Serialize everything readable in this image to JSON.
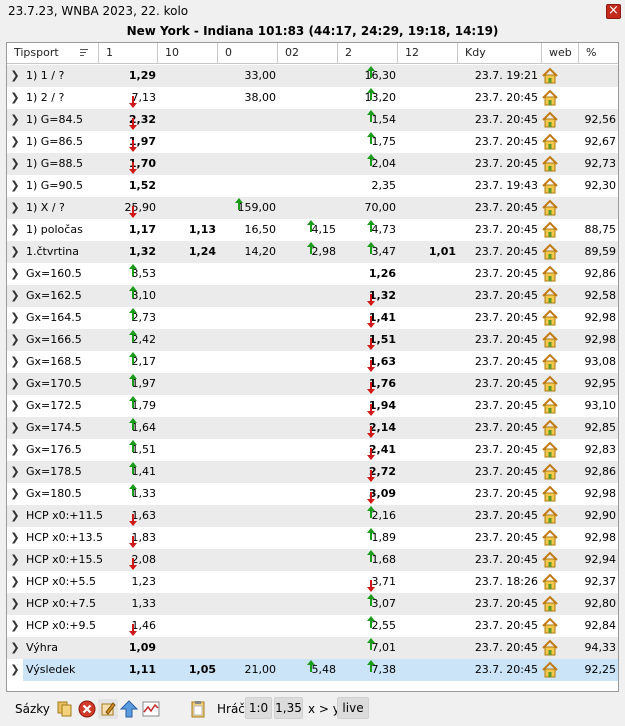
{
  "window": {
    "title": "23.7.23, WNBA 2023, 22. kolo",
    "close_symbol": "×"
  },
  "match_header": "New York - Indiana 101:83 (44:17, 24:29, 19:18, 14:19)",
  "columns": [
    "Tipsport",
    "1",
    "10",
    "0",
    "02",
    "2",
    "12",
    "Kdy",
    "web",
    "%"
  ],
  "colors": {
    "up_arrow": "#1a9c1a",
    "down_arrow": "#d01818",
    "alt_row": "#ebebeb",
    "selected_row": "#cce4f7",
    "house_icon": "#d99a1e"
  },
  "rows": [
    {
      "name": "1) 1 / ?",
      "c1": "1,29",
      "c1b": true,
      "c3": "33,00",
      "c5": "16,30",
      "c5a": "up",
      "kdy": "23.7. 19:21",
      "pct": ""
    },
    {
      "name": "1) 2 / ?",
      "c1": "7,13",
      "c1a": "down",
      "c3": "38,00",
      "c5": "13,20",
      "c5a": "up",
      "kdy": "23.7. 20:45",
      "pct": ""
    },
    {
      "name": "1) G=84.5",
      "c1": "2,32",
      "c1b": true,
      "c1a": "down",
      "c5": "1,54",
      "c5a": "up",
      "kdy": "23.7. 20:45",
      "pct": "92,56"
    },
    {
      "name": "1) G=86.5",
      "c1": "1,97",
      "c1b": true,
      "c1a": "down",
      "c5": "1,75",
      "c5a": "up",
      "kdy": "23.7. 20:45",
      "pct": "92,67"
    },
    {
      "name": "1) G=88.5",
      "c1": "1,70",
      "c1b": true,
      "c1a": "down",
      "c5": "2,04",
      "c5a": "up",
      "kdy": "23.7. 20:45",
      "pct": "92,73"
    },
    {
      "name": "1) G=90.5",
      "c1": "1,52",
      "c1b": true,
      "c5": "2,35",
      "kdy": "23.7. 19:43",
      "pct": "92,30"
    },
    {
      "name": "1) X / ?",
      "c1": "25,90",
      "c1a": "down",
      "c3": "159,00",
      "c3a": "up",
      "c5": "70,00",
      "kdy": "23.7. 20:45",
      "pct": ""
    },
    {
      "name": "1) poločas",
      "c1": "1,17",
      "c1b": true,
      "c2": "1,13",
      "c2b": true,
      "c3": "16,50",
      "c4": "4,15",
      "c4a": "up",
      "c5": "4,73",
      "c5a": "up",
      "kdy": "23.7. 20:45",
      "pct": "88,75"
    },
    {
      "name": "1.čtvrtina",
      "c1": "1,32",
      "c1b": true,
      "c2": "1,24",
      "c2b": true,
      "c3": "14,20",
      "c4": "2,98",
      "c4a": "up",
      "c5": "3,47",
      "c5a": "up",
      "c6": "1,01",
      "c6b": true,
      "kdy": "23.7. 20:45",
      "pct": "89,59"
    },
    {
      "name": "Gx=160.5",
      "c1": "3,53",
      "c1a": "up",
      "c5": "1,26",
      "c5b": true,
      "kdy": "23.7. 20:45",
      "pct": "92,86"
    },
    {
      "name": "Gx=162.5",
      "c1": "3,10",
      "c1a": "up",
      "c5": "1,32",
      "c5b": true,
      "c5a": "down",
      "kdy": "23.7. 20:45",
      "pct": "92,58"
    },
    {
      "name": "Gx=164.5",
      "c1": "2,73",
      "c1a": "up",
      "c5": "1,41",
      "c5b": true,
      "c5a": "down",
      "kdy": "23.7. 20:45",
      "pct": "92,98"
    },
    {
      "name": "Gx=166.5",
      "c1": "2,42",
      "c1a": "up",
      "c5": "1,51",
      "c5b": true,
      "c5a": "down",
      "kdy": "23.7. 20:45",
      "pct": "92,98"
    },
    {
      "name": "Gx=168.5",
      "c1": "2,17",
      "c1a": "up",
      "c5": "1,63",
      "c5b": true,
      "c5a": "down",
      "kdy": "23.7. 20:45",
      "pct": "93,08"
    },
    {
      "name": "Gx=170.5",
      "c1": "1,97",
      "c1a": "up",
      "c5": "1,76",
      "c5b": true,
      "c5a": "down",
      "kdy": "23.7. 20:45",
      "pct": "92,95"
    },
    {
      "name": "Gx=172.5",
      "c1": "1,79",
      "c1a": "up",
      "c5": "1,94",
      "c5b": true,
      "c5a": "down",
      "kdy": "23.7. 20:45",
      "pct": "93,10"
    },
    {
      "name": "Gx=174.5",
      "c1": "1,64",
      "c1a": "up",
      "c5": "2,14",
      "c5b": true,
      "c5a": "down",
      "kdy": "23.7. 20:45",
      "pct": "92,85"
    },
    {
      "name": "Gx=176.5",
      "c1": "1,51",
      "c1a": "up",
      "c5": "2,41",
      "c5b": true,
      "c5a": "down",
      "kdy": "23.7. 20:45",
      "pct": "92,83"
    },
    {
      "name": "Gx=178.5",
      "c1": "1,41",
      "c1a": "up",
      "c5": "2,72",
      "c5b": true,
      "c5a": "down",
      "kdy": "23.7. 20:45",
      "pct": "92,86"
    },
    {
      "name": "Gx=180.5",
      "c1": "1,33",
      "c1a": "up",
      "c5": "3,09",
      "c5b": true,
      "c5a": "down",
      "kdy": "23.7. 20:45",
      "pct": "92,98"
    },
    {
      "name": "HCP x0:+11.5",
      "c1": "1,63",
      "c1a": "down",
      "c5": "2,16",
      "c5a": "up",
      "kdy": "23.7. 20:45",
      "pct": "92,90"
    },
    {
      "name": "HCP x0:+13.5",
      "c1": "1,83",
      "c1a": "down",
      "c5": "1,89",
      "c5a": "up",
      "kdy": "23.7. 20:45",
      "pct": "92,98"
    },
    {
      "name": "HCP x0:+15.5",
      "c1": "2,08",
      "c1a": "down",
      "c5": "1,68",
      "c5a": "up",
      "kdy": "23.7. 20:45",
      "pct": "92,94"
    },
    {
      "name": "HCP x0:+5.5",
      "c1": "1,23",
      "c5": "3,71",
      "c5a": "down",
      "kdy": "23.7. 18:26",
      "pct": "92,37"
    },
    {
      "name": "HCP x0:+7.5",
      "c1": "1,33",
      "c5": "3,07",
      "c5a": "up",
      "kdy": "23.7. 20:45",
      "pct": "92,80"
    },
    {
      "name": "HCP x0:+9.5",
      "c1": "1,46",
      "c1a": "down",
      "c5": "2,55",
      "c5a": "up",
      "kdy": "23.7. 20:45",
      "pct": "92,84"
    },
    {
      "name": "Výhra",
      "c1": "1,09",
      "c1b": true,
      "c5": "7,01",
      "c5a": "up",
      "kdy": "23.7. 20:45",
      "pct": "94,33"
    },
    {
      "name": "Výsledek",
      "c1": "1,11",
      "c1b": true,
      "c2": "1,05",
      "c2b": true,
      "c3": "21,00",
      "c4": "5,48",
      "c4a": "up",
      "c5": "7,38",
      "c5a": "up",
      "kdy": "23.7. 20:45",
      "pct": "92,25",
      "selected": true
    }
  ],
  "toolbar": {
    "sazky_label": "Sázky",
    "hraci_label": "Hráči",
    "btn_score": "1:0",
    "btn_odds": "1,35",
    "compare_label": "x > y",
    "btn_live": "live"
  }
}
